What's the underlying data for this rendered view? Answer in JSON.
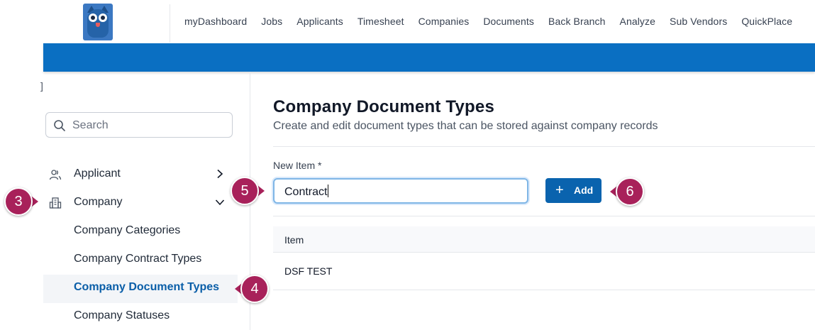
{
  "nav": {
    "links": [
      "myDashboard",
      "Jobs",
      "Applicants",
      "Timesheet",
      "Companies",
      "Documents",
      "Back Branch",
      "Analyze",
      "Sub Vendors",
      "QuickPlace"
    ]
  },
  "sidebar": {
    "search_placeholder": "Search",
    "items": [
      {
        "label": "Applicant",
        "icon": "users-icon",
        "state": "collapsed"
      },
      {
        "label": "Company",
        "icon": "building-icon",
        "state": "expanded"
      }
    ],
    "sub_items": [
      "Company Categories",
      "Company Contract Types",
      "Company Document Types",
      "Company Statuses"
    ],
    "active_sub_item": "Company Document Types"
  },
  "main": {
    "title": "Company Document Types",
    "subtitle": "Create and edit document types that can be stored against company records",
    "field_label": "New Item *",
    "input_value": "Contract",
    "add_label": "Add",
    "table": {
      "header": "Item",
      "rows": [
        "DSF TEST"
      ]
    }
  },
  "callouts": [
    "3",
    "4",
    "5",
    "6"
  ],
  "colors": {
    "brand_blue": "#0a6fc2",
    "button_blue": "#0a63ae",
    "callout": "#a8215a",
    "active_link": "#0a5ea8"
  }
}
